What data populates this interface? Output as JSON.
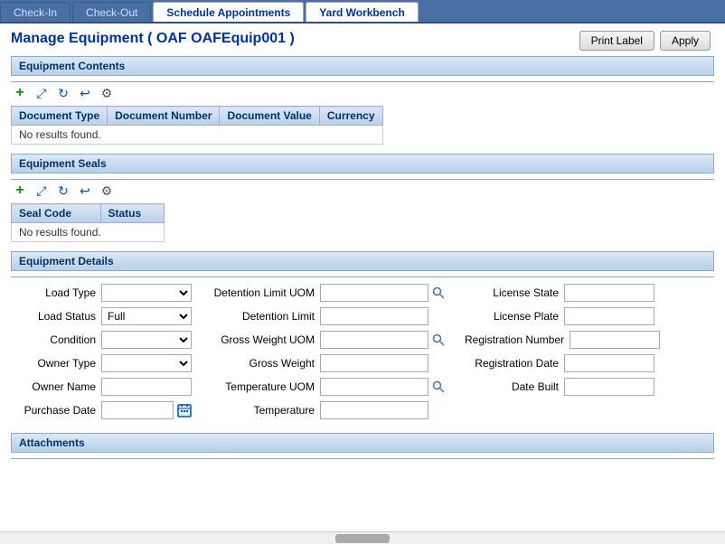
{
  "tabs": [
    {
      "id": "check-in",
      "label": "Check-In",
      "active": false
    },
    {
      "id": "check-out",
      "label": "Check-Out",
      "active": false
    },
    {
      "id": "schedule-appointments",
      "label": "Schedule Appointments",
      "active": false
    },
    {
      "id": "yard-workbench",
      "label": "Yard Workbench",
      "active": true
    }
  ],
  "page": {
    "title": "Manage Equipment ( OAF OAFEquip001 )"
  },
  "buttons": {
    "print_label": "Print Label",
    "apply": "Apply"
  },
  "equipment_contents": {
    "section_title": "Equipment Contents",
    "columns": [
      "Document Type",
      "Document Number",
      "Document Value",
      "Currency"
    ],
    "no_results": "No results found."
  },
  "equipment_seals": {
    "section_title": "Equipment Seals",
    "columns": [
      "Seal Code",
      "Status"
    ],
    "no_results": "No results found."
  },
  "equipment_details": {
    "section_title": "Equipment Details",
    "fields": {
      "load_type_label": "Load Type",
      "load_status_label": "Load Status",
      "load_status_value": "Full",
      "condition_label": "Condition",
      "owner_type_label": "Owner Type",
      "owner_name_label": "Owner Name",
      "purchase_date_label": "Purchase Date",
      "detention_limit_uom_label": "Detention Limit UOM",
      "detention_limit_label": "Detention Limit",
      "gross_weight_uom_label": "Gross Weight UOM",
      "gross_weight_label": "Gross Weight",
      "temperature_uom_label": "Temperature UOM",
      "temperature_label": "Temperature",
      "license_state_label": "License State",
      "license_plate_label": "License Plate",
      "registration_number_label": "Registration Number",
      "registration_date_label": "Registration Date",
      "date_built_label": "Date Built"
    }
  },
  "attachments": {
    "section_title": "Attachments"
  },
  "icons": {
    "add": "+",
    "expand": "⤢",
    "refresh": "↻",
    "undo": "↩",
    "gear": "⚙",
    "search": "🔍",
    "calendar": "📅"
  }
}
